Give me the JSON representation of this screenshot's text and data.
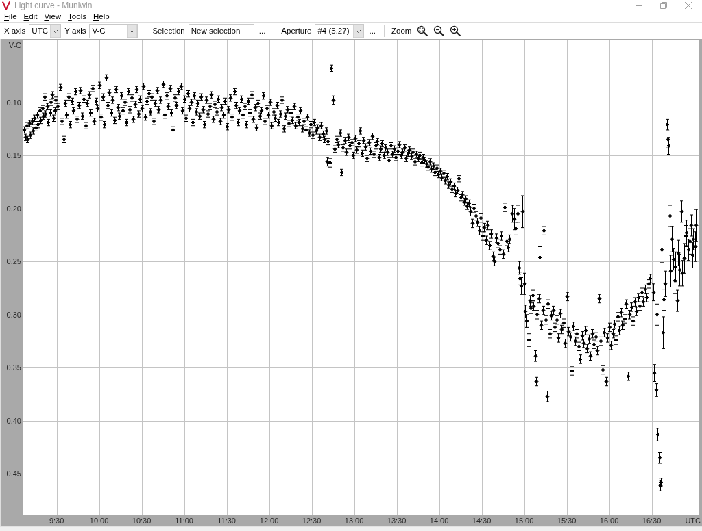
{
  "window": {
    "title": "Light curve - Muniwin"
  },
  "menu": [
    {
      "label": "File"
    },
    {
      "label": "Edit"
    },
    {
      "label": "View"
    },
    {
      "label": "Tools"
    },
    {
      "label": "Help"
    }
  ],
  "toolbar": {
    "x_axis": {
      "label": "X axis",
      "value": "UTC"
    },
    "y_axis": {
      "label": "Y axis",
      "value": "V-C"
    },
    "selection": {
      "label": "Selection",
      "value": "New selection",
      "more": "..."
    },
    "aperture": {
      "label": "Aperture",
      "value": "#4 (5.27)",
      "more": "..."
    },
    "zoom": {
      "label": "Zoom"
    }
  },
  "plot": {
    "chart_data": {
      "type": "scatter",
      "grid": true,
      "xlabel": "UTC",
      "ylabel": "V-C",
      "xlim": [
        9.1,
        17.06
      ],
      "ylim": [
        0.489,
        0.041
      ],
      "xticks": [
        {
          "value": 9.5,
          "label": "9:30"
        },
        {
          "value": 10,
          "label": "10:00"
        },
        {
          "value": 10.5,
          "label": "10:30"
        },
        {
          "value": 11,
          "label": "11:00"
        },
        {
          "value": 11.5,
          "label": "11:30"
        },
        {
          "value": 12,
          "label": "12:00"
        },
        {
          "value": 12.5,
          "label": "12:30"
        },
        {
          "value": 13,
          "label": "13:00"
        },
        {
          "value": 13.5,
          "label": "13:30"
        },
        {
          "value": 14,
          "label": "14:00"
        },
        {
          "value": 14.5,
          "label": "14:30"
        },
        {
          "value": 15,
          "label": "15:00"
        },
        {
          "value": 15.5,
          "label": "15:30"
        },
        {
          "value": 16,
          "label": "16:00"
        },
        {
          "value": 16.5,
          "label": "16:30"
        }
      ],
      "yticks": [
        {
          "value": 0.1,
          "label": "0.10"
        },
        {
          "value": 0.15,
          "label": "0.15"
        },
        {
          "value": 0.2,
          "label": "0.20"
        },
        {
          "value": 0.25,
          "label": "0.25"
        },
        {
          "value": 0.3,
          "label": "0.30"
        },
        {
          "value": 0.35,
          "label": "0.35"
        },
        {
          "value": 0.4,
          "label": "0.40"
        },
        {
          "value": 0.45,
          "label": "0.45"
        }
      ],
      "x": [
        9.12,
        9.13,
        9.15,
        9.16,
        9.18,
        9.19,
        9.21,
        9.22,
        9.24,
        9.25,
        9.27,
        9.28,
        9.3,
        9.31,
        9.33,
        9.34,
        9.36,
        9.37,
        9.39,
        9.4,
        9.42,
        9.43,
        9.45,
        9.46,
        9.48,
        9.49,
        9.51,
        9.54,
        9.56,
        9.58,
        9.6,
        9.62,
        9.64,
        9.66,
        9.68,
        9.7,
        9.72,
        9.74,
        9.76,
        9.78,
        9.8,
        9.82,
        9.84,
        9.86,
        9.88,
        9.9,
        9.92,
        9.94,
        9.96,
        9.98,
        10.0,
        10.02,
        10.04,
        10.06,
        10.08,
        10.1,
        10.12,
        10.14,
        10.16,
        10.18,
        10.2,
        10.22,
        10.24,
        10.26,
        10.28,
        10.3,
        10.32,
        10.34,
        10.36,
        10.38,
        10.4,
        10.42,
        10.44,
        10.46,
        10.48,
        10.5,
        10.52,
        10.54,
        10.56,
        10.58,
        10.6,
        10.62,
        10.64,
        10.66,
        10.68,
        10.7,
        10.72,
        10.75,
        10.77,
        10.79,
        10.81,
        10.83,
        10.85,
        10.87,
        10.89,
        10.91,
        10.93,
        10.96,
        10.98,
        11.0,
        11.02,
        11.04,
        11.06,
        11.08,
        11.1,
        11.12,
        11.14,
        11.16,
        11.18,
        11.2,
        11.22,
        11.24,
        11.26,
        11.28,
        11.3,
        11.32,
        11.34,
        11.36,
        11.38,
        11.4,
        11.42,
        11.44,
        11.46,
        11.48,
        11.5,
        11.52,
        11.54,
        11.56,
        11.59,
        11.61,
        11.63,
        11.65,
        11.67,
        11.69,
        11.71,
        11.73,
        11.75,
        11.77,
        11.79,
        11.81,
        11.83,
        11.85,
        11.87,
        11.89,
        11.91,
        11.93,
        11.95,
        11.97,
        11.99,
        12.01,
        12.03,
        12.05,
        12.07,
        12.09,
        12.11,
        12.13,
        12.15,
        12.17,
        12.19,
        12.21,
        12.23,
        12.25,
        12.27,
        12.29,
        12.31,
        12.33,
        12.35,
        12.37,
        12.39,
        12.41,
        12.43,
        12.45,
        12.47,
        12.49,
        12.51,
        12.53,
        12.55,
        12.57,
        12.59,
        12.61,
        12.63,
        12.65,
        12.67,
        12.68,
        12.69,
        12.71,
        12.73,
        12.75,
        12.77,
        12.79,
        12.81,
        12.83,
        12.85,
        12.87,
        12.89,
        12.91,
        12.93,
        12.95,
        12.97,
        12.99,
        13.01,
        13.03,
        13.05,
        13.07,
        13.09,
        13.11,
        13.13,
        13.15,
        13.17,
        13.19,
        13.21,
        13.23,
        13.25,
        13.27,
        13.29,
        13.31,
        13.33,
        13.35,
        13.37,
        13.39,
        13.41,
        13.43,
        13.45,
        13.47,
        13.49,
        13.51,
        13.53,
        13.55,
        13.57,
        13.59,
        13.61,
        13.63,
        13.65,
        13.67,
        13.69,
        13.71,
        13.73,
        13.75,
        13.77,
        13.79,
        13.81,
        13.83,
        13.85,
        13.87,
        13.89,
        13.91,
        13.93,
        13.95,
        13.97,
        13.99,
        14.01,
        14.03,
        14.05,
        14.07,
        14.09,
        14.11,
        14.13,
        14.15,
        14.17,
        14.19,
        14.21,
        14.23,
        14.25,
        14.27,
        14.29,
        14.31,
        14.33,
        14.35,
        14.37,
        14.39,
        14.41,
        14.43,
        14.45,
        14.47,
        14.49,
        14.51,
        14.53,
        14.55,
        14.57,
        14.59,
        14.61,
        14.63,
        14.65,
        14.67,
        14.69,
        14.71,
        14.73,
        14.75,
        14.77,
        14.79,
        14.81,
        14.83,
        14.86,
        14.88,
        14.9,
        14.92,
        14.94,
        14.95,
        14.96,
        14.98,
        15.0,
        15.01,
        15.03,
        15.05,
        15.07,
        15.08,
        15.1,
        15.13,
        15.14,
        15.18,
        15.23,
        15.27,
        15.11,
        15.15,
        15.17,
        15.2,
        15.22,
        15.25,
        15.28,
        15.3,
        15.32,
        15.34,
        15.36,
        15.38,
        15.4,
        15.42,
        15.44,
        15.46,
        15.48,
        15.5,
        15.52,
        15.54,
        15.56,
        15.58,
        15.6,
        15.62,
        15.64,
        15.66,
        15.68,
        15.7,
        15.72,
        15.74,
        15.76,
        15.78,
        15.8,
        15.82,
        15.84,
        15.86,
        15.88,
        15.9,
        15.92,
        15.94,
        15.96,
        15.98,
        16.0,
        16.02,
        16.04,
        16.06,
        16.08,
        16.1,
        16.12,
        16.14,
        16.16,
        16.18,
        16.2,
        16.22,
        16.24,
        16.26,
        16.28,
        16.3,
        16.32,
        16.34,
        16.36,
        16.38,
        16.4,
        16.42,
        16.44,
        16.46,
        16.48,
        16.52,
        16.53,
        16.55,
        16.56,
        16.57,
        16.59,
        16.6,
        16.61,
        16.62,
        16.63,
        16.64,
        16.66,
        16.68,
        16.69,
        16.7,
        16.71,
        16.72,
        16.74,
        16.75,
        16.77,
        16.78,
        16.8,
        16.81,
        16.83,
        16.85,
        16.86,
        16.88,
        16.9,
        16.91,
        16.93,
        16.95,
        16.96,
        16.98,
        16.99,
        17.01,
        17.02
      ],
      "series": [
        {
          "color": "#000000",
          "values": [
            0.126,
            0.133,
            0.122,
            0.135,
            0.12,
            0.131,
            0.118,
            0.127,
            0.115,
            0.124,
            0.112,
            0.121,
            0.108,
            0.117,
            0.106,
            0.113,
            0.095,
            0.111,
            0.104,
            0.119,
            0.11,
            0.1,
            0.093,
            0.115,
            0.108,
            0.098,
            0.104,
            0.086,
            0.118,
            0.135,
            0.101,
            0.112,
            0.095,
            0.121,
            0.099,
            0.108,
            0.09,
            0.116,
            0.103,
            0.089,
            0.113,
            0.097,
            0.122,
            0.101,
            0.093,
            0.11,
            0.087,
            0.118,
            0.099,
            0.106,
            0.084,
            0.114,
            0.095,
            0.121,
            0.077,
            0.103,
            0.091,
            0.11,
            0.098,
            0.117,
            0.088,
            0.105,
            0.113,
            0.094,
            0.108,
            0.1,
            0.119,
            0.09,
            0.107,
            0.096,
            0.116,
            0.102,
            0.088,
            0.111,
            0.097,
            0.106,
            0.085,
            0.114,
            0.099,
            0.092,
            0.109,
            0.095,
            0.118,
            0.101,
            0.089,
            0.107,
            0.098,
            0.083,
            0.112,
            0.094,
            0.104,
            0.087,
            0.11,
            0.126,
            0.096,
            0.103,
            0.09,
            0.085,
            0.108,
            0.097,
            0.115,
            0.092,
            0.106,
            0.1,
            0.119,
            0.094,
            0.109,
            0.101,
            0.113,
            0.095,
            0.107,
            0.121,
            0.098,
            0.111,
            0.104,
            0.093,
            0.116,
            0.102,
            0.109,
            0.097,
            0.118,
            0.105,
            0.112,
            0.099,
            0.123,
            0.107,
            0.096,
            0.114,
            0.09,
            0.103,
            0.119,
            0.108,
            0.097,
            0.112,
            0.104,
            0.121,
            0.099,
            0.11,
            0.093,
            0.116,
            0.105,
            0.124,
            0.101,
            0.113,
            0.108,
            0.094,
            0.118,
            0.106,
            0.112,
            0.1,
            0.122,
            0.109,
            0.115,
            0.103,
            0.119,
            0.111,
            0.098,
            0.125,
            0.113,
            0.107,
            0.12,
            0.11,
            0.117,
            0.104,
            0.122,
            0.114,
            0.119,
            0.108,
            0.125,
            0.118,
            0.126,
            0.114,
            0.129,
            0.121,
            0.131,
            0.119,
            0.127,
            0.124,
            0.133,
            0.122,
            0.13,
            0.135,
            0.127,
            0.156,
            0.137,
            0.157,
            0.068,
            0.098,
            0.144,
            0.135,
            0.14,
            0.129,
            0.166,
            0.143,
            0.136,
            0.147,
            0.133,
            0.141,
            0.138,
            0.15,
            0.134,
            0.145,
            0.139,
            0.127,
            0.148,
            0.136,
            0.142,
            0.153,
            0.138,
            0.146,
            0.132,
            0.149,
            0.141,
            0.137,
            0.152,
            0.144,
            0.139,
            0.15,
            0.143,
            0.147,
            0.155,
            0.141,
            0.149,
            0.144,
            0.152,
            0.146,
            0.14,
            0.15,
            0.147,
            0.143,
            0.153,
            0.148,
            0.145,
            0.151,
            0.147,
            0.156,
            0.149,
            0.153,
            0.15,
            0.157,
            0.152,
            0.155,
            0.158,
            0.161,
            0.156,
            0.163,
            0.16,
            0.166,
            0.162,
            0.168,
            0.165,
            0.171,
            0.167,
            0.174,
            0.17,
            0.178,
            0.175,
            0.182,
            0.179,
            0.186,
            0.183,
            0.172,
            0.19,
            0.187,
            0.194,
            0.191,
            0.198,
            0.195,
            0.203,
            0.214,
            0.2,
            0.207,
            0.213,
            0.221,
            0.209,
            0.226,
            0.218,
            0.23,
            0.216,
            0.235,
            0.224,
            0.245,
            0.25,
            0.228,
            0.233,
            0.239,
            0.226,
            0.243,
            0.199,
            0.231,
            0.237,
            0.229,
            0.205,
            0.21,
            0.219,
            0.205,
            0.256,
            0.266,
            0.273,
            0.203,
            0.271,
            0.297,
            0.306,
            0.324,
            0.287,
            0.294,
            0.282,
            0.339,
            0.363,
            0.246,
            0.221,
            0.377,
            0.292,
            0.3,
            0.285,
            0.31,
            0.296,
            0.305,
            0.29,
            0.318,
            0.301,
            0.296,
            0.312,
            0.305,
            0.322,
            0.299,
            0.314,
            0.308,
            0.327,
            0.283,
            0.316,
            0.321,
            0.353,
            0.311,
            0.325,
            0.318,
            0.33,
            0.342,
            0.32,
            0.327,
            0.315,
            0.332,
            0.323,
            0.339,
            0.318,
            0.328,
            0.321,
            0.334,
            0.285,
            0.325,
            0.352,
            0.317,
            0.363,
            0.322,
            0.312,
            0.329,
            0.318,
            0.309,
            0.324,
            0.302,
            0.315,
            0.298,
            0.31,
            0.304,
            0.29,
            0.358,
            0.3,
            0.293,
            0.306,
            0.288,
            0.297,
            0.284,
            0.292,
            0.279,
            0.288,
            0.276,
            0.284,
            0.271,
            0.266,
            0.279,
            0.355,
            0.371,
            0.3,
            0.413,
            0.435,
            0.461,
            0.458,
            0.239,
            0.317,
            0.286,
            0.271,
            0.121,
            0.135,
            0.141,
            0.207,
            0.259,
            0.229,
            0.248,
            0.268,
            0.255,
            0.287,
            0.242,
            0.258,
            0.203,
            0.261,
            0.247,
            0.226,
            0.223,
            0.239,
            0.231,
            0.216,
            0.244,
            0.229,
            0.236,
            0.216
          ],
          "errors": [
            0.003,
            0.003,
            0.003,
            0.003,
            0.003,
            0.003,
            0.003,
            0.003,
            0.003,
            0.003,
            0.003,
            0.003,
            0.003,
            0.003,
            0.003,
            0.003,
            0.003,
            0.003,
            0.003,
            0.003,
            0.003,
            0.003,
            0.003,
            0.003,
            0.003,
            0.003,
            0.003,
            0.003,
            0.003,
            0.003,
            0.003,
            0.003,
            0.003,
            0.003,
            0.003,
            0.003,
            0.003,
            0.003,
            0.003,
            0.003,
            0.003,
            0.003,
            0.003,
            0.003,
            0.003,
            0.003,
            0.003,
            0.003,
            0.003,
            0.003,
            0.003,
            0.003,
            0.003,
            0.003,
            0.003,
            0.003,
            0.003,
            0.003,
            0.003,
            0.003,
            0.003,
            0.003,
            0.003,
            0.003,
            0.003,
            0.003,
            0.003,
            0.003,
            0.003,
            0.003,
            0.003,
            0.003,
            0.003,
            0.003,
            0.003,
            0.003,
            0.003,
            0.003,
            0.003,
            0.003,
            0.003,
            0.003,
            0.003,
            0.003,
            0.003,
            0.003,
            0.003,
            0.003,
            0.003,
            0.003,
            0.003,
            0.003,
            0.003,
            0.003,
            0.003,
            0.003,
            0.003,
            0.003,
            0.003,
            0.003,
            0.003,
            0.003,
            0.003,
            0.003,
            0.003,
            0.003,
            0.003,
            0.003,
            0.003,
            0.003,
            0.003,
            0.003,
            0.003,
            0.003,
            0.003,
            0.003,
            0.003,
            0.003,
            0.003,
            0.003,
            0.003,
            0.003,
            0.003,
            0.003,
            0.003,
            0.003,
            0.003,
            0.003,
            0.003,
            0.003,
            0.003,
            0.003,
            0.003,
            0.003,
            0.003,
            0.003,
            0.003,
            0.003,
            0.003,
            0.003,
            0.003,
            0.003,
            0.003,
            0.003,
            0.003,
            0.003,
            0.003,
            0.003,
            0.003,
            0.003,
            0.003,
            0.003,
            0.003,
            0.003,
            0.003,
            0.003,
            0.003,
            0.003,
            0.003,
            0.003,
            0.003,
            0.003,
            0.003,
            0.003,
            0.003,
            0.003,
            0.003,
            0.003,
            0.003,
            0.003,
            0.003,
            0.003,
            0.003,
            0.003,
            0.003,
            0.003,
            0.003,
            0.003,
            0.003,
            0.003,
            0.003,
            0.003,
            0.003,
            0.004,
            0.003,
            0.004,
            0.003,
            0.004,
            0.003,
            0.003,
            0.003,
            0.003,
            0.003,
            0.003,
            0.003,
            0.003,
            0.003,
            0.003,
            0.003,
            0.003,
            0.003,
            0.003,
            0.003,
            0.003,
            0.003,
            0.003,
            0.003,
            0.003,
            0.003,
            0.003,
            0.003,
            0.003,
            0.003,
            0.003,
            0.003,
            0.003,
            0.003,
            0.003,
            0.003,
            0.003,
            0.003,
            0.003,
            0.003,
            0.003,
            0.003,
            0.003,
            0.003,
            0.003,
            0.003,
            0.003,
            0.003,
            0.003,
            0.003,
            0.003,
            0.003,
            0.003,
            0.003,
            0.003,
            0.003,
            0.003,
            0.003,
            0.003,
            0.003,
            0.003,
            0.003,
            0.003,
            0.003,
            0.003,
            0.003,
            0.003,
            0.003,
            0.003,
            0.003,
            0.003,
            0.003,
            0.003,
            0.003,
            0.003,
            0.003,
            0.003,
            0.003,
            0.003,
            0.003,
            0.003,
            0.003,
            0.003,
            0.003,
            0.003,
            0.004,
            0.004,
            0.004,
            0.004,
            0.004,
            0.004,
            0.004,
            0.004,
            0.004,
            0.004,
            0.004,
            0.004,
            0.004,
            0.004,
            0.004,
            0.004,
            0.004,
            0.004,
            0.004,
            0.004,
            0.004,
            0.004,
            0.004,
            0.004,
            0.008,
            0.01,
            0.006,
            0.008,
            0.006,
            0.006,
            0.008,
            0.015,
            0.01,
            0.006,
            0.006,
            0.006,
            0.005,
            0.005,
            0.005,
            0.005,
            0.004,
            0.01,
            0.004,
            0.005,
            0.004,
            0.004,
            0.004,
            0.004,
            0.004,
            0.004,
            0.004,
            0.004,
            0.004,
            0.004,
            0.004,
            0.004,
            0.004,
            0.004,
            0.004,
            0.004,
            0.004,
            0.004,
            0.004,
            0.004,
            0.004,
            0.004,
            0.004,
            0.004,
            0.004,
            0.004,
            0.004,
            0.004,
            0.004,
            0.004,
            0.004,
            0.004,
            0.004,
            0.004,
            0.004,
            0.004,
            0.004,
            0.004,
            0.004,
            0.004,
            0.004,
            0.004,
            0.004,
            0.004,
            0.004,
            0.004,
            0.004,
            0.004,
            0.004,
            0.004,
            0.004,
            0.004,
            0.004,
            0.004,
            0.004,
            0.004,
            0.004,
            0.004,
            0.004,
            0.004,
            0.004,
            0.004,
            0.004,
            0.004,
            0.004,
            0.004,
            0.004,
            0.008,
            0.008,
            0.006,
            0.01,
            0.006,
            0.005,
            0.005,
            0.004,
            0.012,
            0.015,
            0.01,
            0.012,
            0.005,
            0.008,
            0.008,
            0.01,
            0.015,
            0.012,
            0.01,
            0.012,
            0.014,
            0.01,
            0.012,
            0.015,
            0.01,
            0.012,
            0.014,
            0.01,
            0.012,
            0.01,
            0.012,
            0.01,
            0.012,
            0.01,
            0.014,
            0.015
          ]
        }
      ]
    }
  }
}
